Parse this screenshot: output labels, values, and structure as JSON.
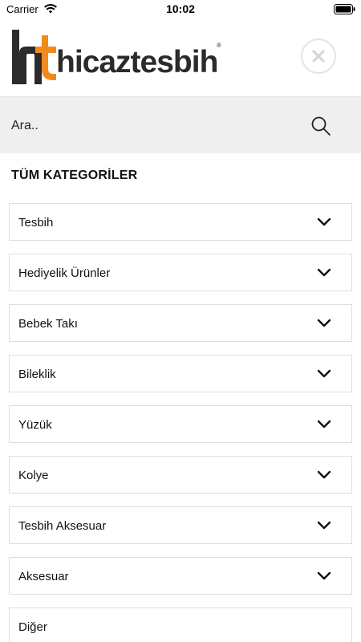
{
  "status_bar": {
    "carrier": "Carrier",
    "time": "10:02"
  },
  "header": {
    "logo_text": "hicaztesbih",
    "logo_registered": "®",
    "brand_colors": {
      "orange": "#f28a1e",
      "dark": "#2b2b2b"
    },
    "close_icon": "close-icon"
  },
  "search": {
    "placeholder": "Ara..",
    "value": "",
    "icon": "search-icon"
  },
  "categories": {
    "title": "TÜM KATEGORİLER",
    "items": [
      {
        "label": "Tesbih",
        "expandable": true
      },
      {
        "label": "Hediyelik Ürünler",
        "expandable": true
      },
      {
        "label": "Bebek Takı",
        "expandable": true
      },
      {
        "label": "Bileklik",
        "expandable": true
      },
      {
        "label": "Yüzük",
        "expandable": true
      },
      {
        "label": "Kolye",
        "expandable": true
      },
      {
        "label": "Tesbih Aksesuar",
        "expandable": true
      },
      {
        "label": "Aksesuar",
        "expandable": true
      },
      {
        "label": "Diğer",
        "expandable": false
      }
    ]
  }
}
